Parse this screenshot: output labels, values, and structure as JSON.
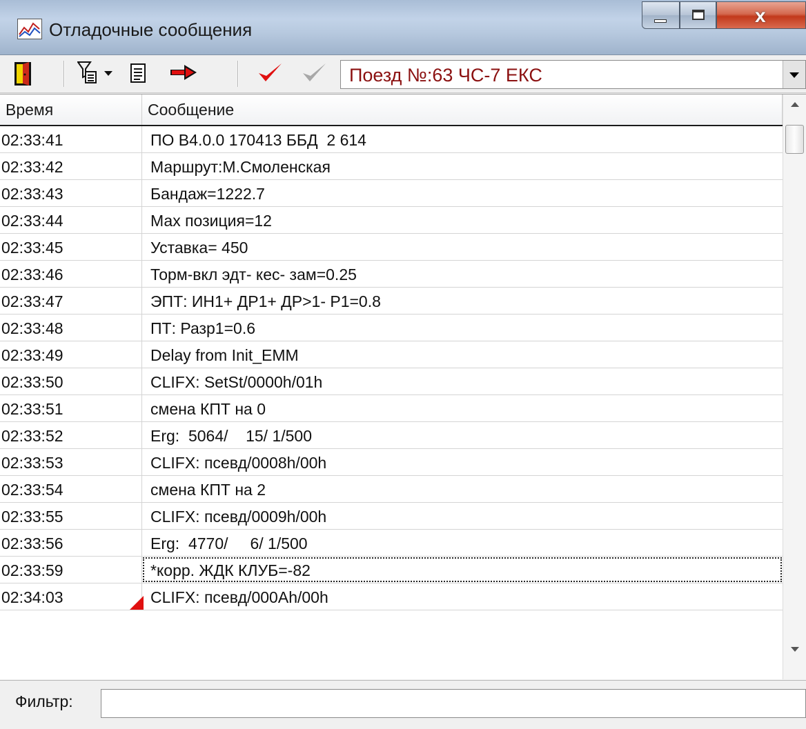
{
  "window": {
    "title": "Отладочные сообщения",
    "buttons": {
      "minimize": "minimize",
      "maximize": "maximize",
      "close": "x"
    }
  },
  "toolbar": {
    "icons": [
      "exit-door-icon",
      "filter-icon",
      "dropdown-arrow-icon",
      "document-icon",
      "red-arrow-icon",
      "check-red-icon",
      "check-gray-icon"
    ],
    "combo_value": "Поезд №:63  ЧС-7 ЕКС",
    "colors": {
      "combo_text": "#8b1010",
      "red_icon": "#e01010"
    }
  },
  "list": {
    "columns": [
      "Время",
      "Сообщение"
    ],
    "rows": [
      {
        "time": "02:33:41",
        "message": "ПО В4.0.0 170413 ББД  2 614"
      },
      {
        "time": "02:33:42",
        "message": "Маршрут:М.Смоленская"
      },
      {
        "time": "02:33:43",
        "message": "Бандаж=1222.7"
      },
      {
        "time": "02:33:44",
        "message": "Мах позиция=12"
      },
      {
        "time": "02:33:45",
        "message": "Уставка= 450"
      },
      {
        "time": "02:33:46",
        "message": "Торм-вкл эдт- кес- зам=0.25"
      },
      {
        "time": "02:33:47",
        "message": "ЭПТ: ИН1+ ДР1+ ДР>1- Р1=0.8"
      },
      {
        "time": "02:33:48",
        "message": "ПТ: Разр1=0.6"
      },
      {
        "time": "02:33:49",
        "message": "Delay from Init_EMM"
      },
      {
        "time": "02:33:50",
        "message": "CLIFX: SetSt/0000h/01h"
      },
      {
        "time": "02:33:51",
        "message": "смена КПТ на 0"
      },
      {
        "time": "02:33:52",
        "message": "Erg:  5064/    15/ 1/500"
      },
      {
        "time": "02:33:53",
        "message": "CLIFX: псевд/0008h/00h"
      },
      {
        "time": "02:33:54",
        "message": "смена КПТ на 2"
      },
      {
        "time": "02:33:55",
        "message": "CLIFX: псевд/0009h/00h"
      },
      {
        "time": "02:33:56",
        "message": "Erg:  4770/     6/ 1/500"
      },
      {
        "time": "02:33:59",
        "message": "*корр. ЖДК КЛУБ=-82",
        "focused": true
      },
      {
        "time": "02:34:03",
        "message": "CLIFX: псевд/000Ah/00h",
        "marker": true
      }
    ]
  },
  "filter": {
    "label": "Фильтр:",
    "value": ""
  }
}
